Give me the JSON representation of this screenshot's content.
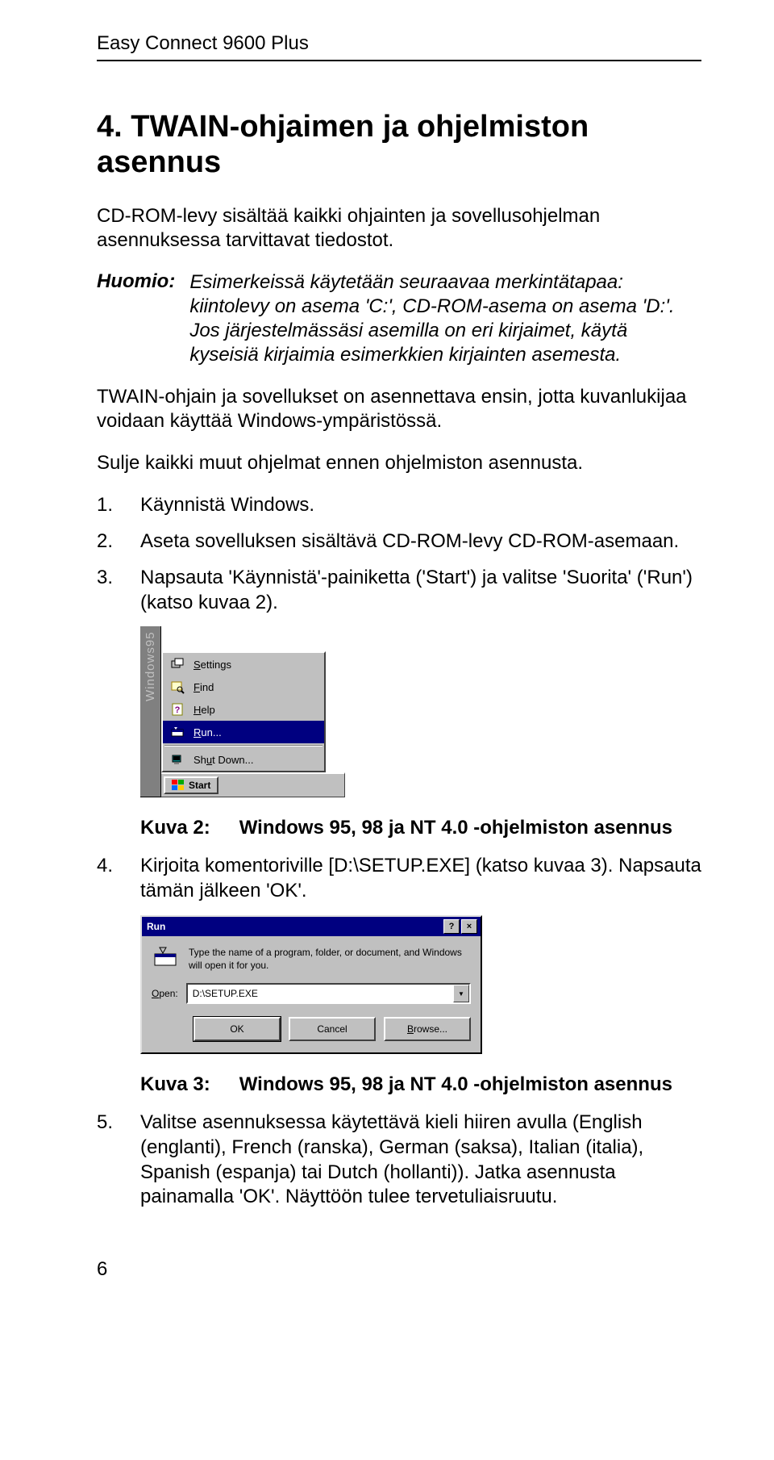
{
  "header": {
    "title": "Easy Connect 9600 Plus"
  },
  "section_heading": "4. TWAIN-ohjaimen ja ohjelmiston asennus",
  "intro": "CD-ROM-levy sisältää kaikki ohjainten ja sovellusohjelman asennuksessa tarvittavat tiedostot.",
  "huomio": {
    "label": "Huomio:",
    "text": "Esimerkeissä käytetään seuraavaa merkintätapaa: kiintolevy on asema 'C:', CD-ROM-asema on asema 'D:'. Jos järjestelmässäsi asemilla on eri kirjaimet, käytä kyseisiä kirjaimia esimerkkien kirjainten asemesta."
  },
  "para_twain": "TWAIN-ohjain ja sovellukset on asennettava ensin, jotta kuvanlukijaa voidaan käyttää Windows-ympäristössä.",
  "para_close": "Sulje kaikki muut ohjelmat ennen ohjelmiston asennusta.",
  "steps_a": [
    {
      "n": "1.",
      "t": "Käynnistä Windows."
    },
    {
      "n": "2.",
      "t": "Aseta sovelluksen sisältävä CD-ROM-levy CD-ROM-asemaan."
    },
    {
      "n": "3.",
      "t": "Napsauta 'Käynnistä'-painiketta ('Start') ja valitse 'Suorita' ('Run') (katso kuvaa 2)."
    }
  ],
  "startmenu": {
    "sidebar": "Windows95",
    "items": [
      {
        "icon": "settings",
        "pre": "S",
        "post": "ettings"
      },
      {
        "icon": "find",
        "pre": "F",
        "post": "ind"
      },
      {
        "icon": "help",
        "pre": "H",
        "post": "elp"
      },
      {
        "icon": "run",
        "pre": "R",
        "post": "un..."
      }
    ],
    "shutdown": {
      "pre": "Sh",
      "u": "u",
      "post": "t Down..."
    },
    "start_label": "Start"
  },
  "caption2": {
    "label": "Kuva 2:",
    "text": "Windows 95, 98 ja NT 4.0 -ohjelmiston asennus"
  },
  "steps_b": [
    {
      "n": "4.",
      "t": "Kirjoita komentoriville [D:\\SETUP.EXE] (katso kuvaa 3). Napsauta tämän jälkeen 'OK'."
    }
  ],
  "run_dialog": {
    "title": "Run",
    "help_glyph": "?",
    "close_glyph": "×",
    "desc": "Type the name of a program, folder, or document, and Windows will open it for you.",
    "open_label_pre": "O",
    "open_label_post": "pen:",
    "value": "D:\\SETUP.EXE",
    "dropdown_glyph": "▼",
    "buttons": {
      "ok": "OK",
      "cancel": "Cancel",
      "browse_pre": "B",
      "browse_post": "rowse..."
    }
  },
  "caption3": {
    "label": "Kuva 3:",
    "text": "Windows 95, 98 ja NT 4.0 -ohjelmiston asennus"
  },
  "steps_c": [
    {
      "n": "5.",
      "t": "Valitse asennuksessa käytettävä kieli hiiren avulla (English (englanti), French (ranska), German (saksa), Italian (italia), Spanish (espanja) tai Dutch (hollanti)). Jatka asennusta painamalla 'OK'. Näyttöön tulee tervetuliaisruutu."
    }
  ],
  "page_number": "6"
}
